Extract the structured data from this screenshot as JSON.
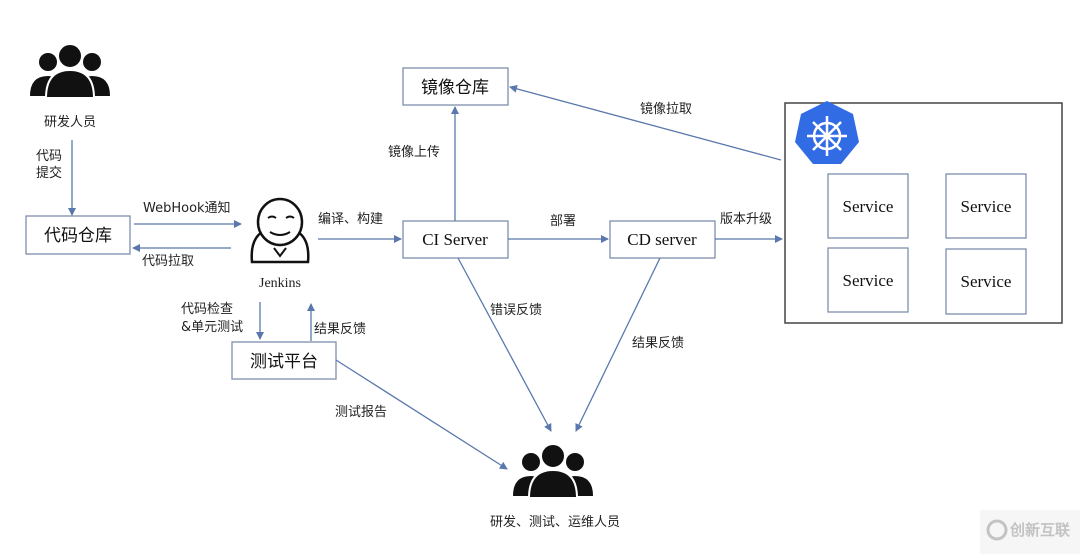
{
  "nodes": {
    "developers": "研发人员",
    "code_repo": "代码仓库",
    "jenkins": "Jenkins",
    "ci_server": "CI Server",
    "image_repo": "镜像仓库",
    "cd_server": "CD server",
    "test_platform": "测试平台",
    "services": [
      "Service",
      "Service",
      "Service",
      "Service"
    ],
    "staff": "研发、测试、运维人员"
  },
  "edges": {
    "commit": [
      "代码",
      "提交"
    ],
    "webhook": "WebHook通知",
    "pull_code": "代码拉取",
    "build": "编译、构建",
    "image_push": "镜像上传",
    "deploy": "部署",
    "upgrade": "版本升级",
    "image_pull": "镜像拉取",
    "check_test": [
      "代码检查",
      "&单元测试"
    ],
    "test_feedback": "结果反馈",
    "test_report": "测试报告",
    "error_feedback": "错误反馈",
    "cd_feedback": "结果反馈"
  },
  "colors": {
    "line": "#5a78ad",
    "kubernetes": "#326ce5"
  },
  "icons": [
    "people-group-icon",
    "jenkins-butler-icon",
    "kubernetes-helm-icon"
  ],
  "watermark": "创新互联"
}
